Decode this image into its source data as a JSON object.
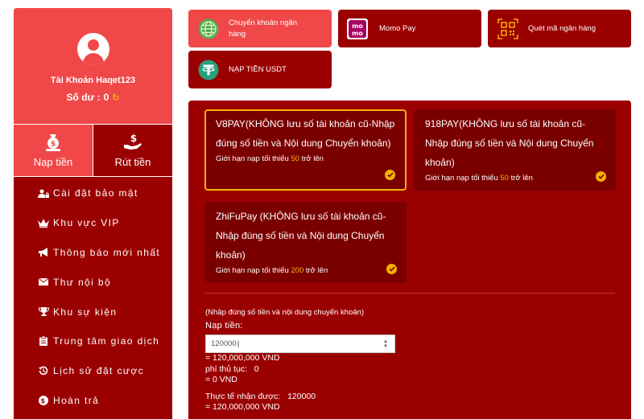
{
  "sidebar": {
    "username": "Tài Khoản Haqet123",
    "balance_label": "Số dư :",
    "balance_value": "0",
    "actions": [
      {
        "label": "Nạp tiền"
      },
      {
        "label": "Rút tiền"
      }
    ],
    "menu": [
      {
        "label": "Cài đặt bảo mật",
        "icon": "user-lock-icon"
      },
      {
        "label": "Khu vực VIP",
        "icon": "crown-icon"
      },
      {
        "label": "Thông báo mới nhất",
        "icon": "megaphone-icon"
      },
      {
        "label": "Thư nội bộ",
        "icon": "envelope-icon"
      },
      {
        "label": "Khu sự kiện",
        "icon": "trophy-icon"
      },
      {
        "label": "Trung tâm giao dịch",
        "icon": "clipboard-icon"
      },
      {
        "label": "Lịch sử đặt cược",
        "icon": "history-icon"
      },
      {
        "label": "Hoàn trả",
        "icon": "dollar-circle-icon"
      }
    ]
  },
  "tabs": [
    {
      "label": "Chuyển khoản ngân hàng",
      "icon": "globe-icon"
    },
    {
      "label": "Momo Pay",
      "icon": "momo-logo"
    },
    {
      "label": "Quét mã ngân hàng",
      "icon": "qr-code-icon"
    },
    {
      "label": "NẠP TIỀN USDT",
      "icon": "tether-icon"
    }
  ],
  "channels": [
    {
      "title": "V8PAY(KHÔNG lưu số tài khoản cũ-Nhập đúng số tiền và Nội dung Chuyển khoản)",
      "limit_prefix": "Giới hạn nạp tối thiểu",
      "limit_amount": "50",
      "limit_suffix": "trở lên"
    },
    {
      "title": "918PAY(KHÔNG lưu số tài khoản cũ-Nhập đúng số tiền và Nội dung Chuyển khoản)",
      "limit_prefix": "Giới hạn nạp tối thiểu",
      "limit_amount": "50",
      "limit_suffix": "trở lên"
    },
    {
      "title": "ZhiFuPay  (KHÔNG lưu số tài khoản cũ-Nhập đúng số tiền và Nội dung Chuyển khoản)",
      "limit_prefix": "Giới hạn nạp tối thiểu",
      "limit_amount": "200",
      "limit_suffix": "trở lên"
    }
  ],
  "form": {
    "hint": "(Nhập đúng số tiền và nội dung chuyển khoản)",
    "amount_label": "Nạp tiền:",
    "amount_value": "120000",
    "amount_converted": "= 120,000,000 VND",
    "fee_line": "phí thủ tục:   0",
    "fee_converted": "= 0 VND",
    "actual_line": "Thực tế nhận được:   120000",
    "actual_converted": "= 120,000,000 VND"
  },
  "colors": {
    "primary_dark": "#9b0000",
    "primary_light": "#f04848",
    "card": "#7a0000",
    "accent": "#f5b100"
  }
}
